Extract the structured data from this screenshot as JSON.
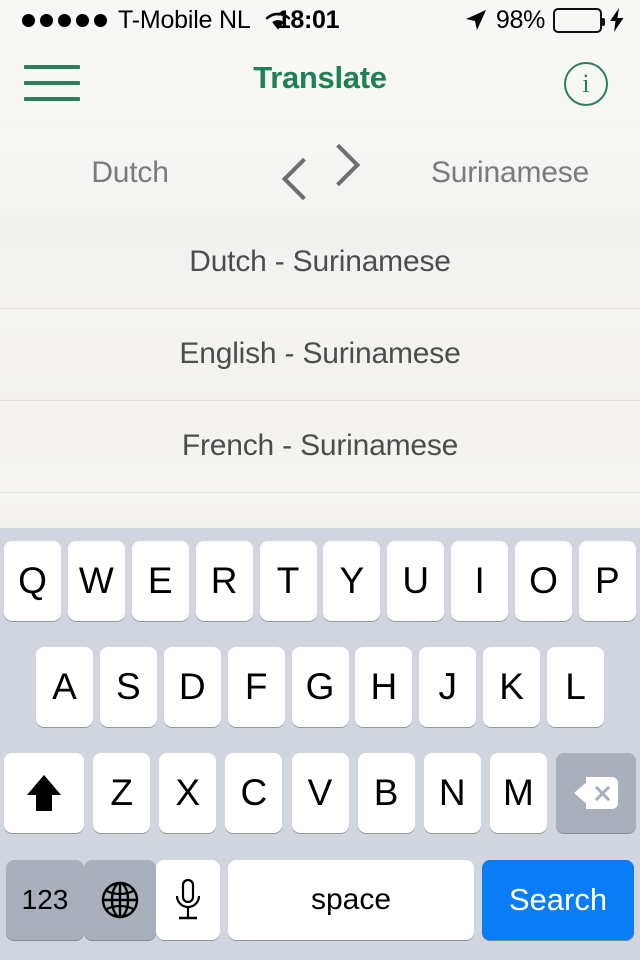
{
  "status_bar": {
    "signal_dots": 5,
    "carrier": "T-Mobile NL",
    "wifi_icon": "wifi-icon",
    "time": "18:01",
    "location_icon": "location-arrow-icon",
    "battery_percent": "98%",
    "battery_color": "#4cd964",
    "charging": true
  },
  "nav_bar": {
    "menu_icon": "hamburger-menu-icon",
    "title": "Translate",
    "info_label": "i",
    "accent_color": "#1f8055"
  },
  "language_picker": {
    "source_language": "Dutch",
    "target_language": "Surinamese",
    "swap_icon": "swap-chevrons-icon"
  },
  "suggestions": [
    {
      "label": "Dutch - Surinamese"
    },
    {
      "label": "English - Surinamese"
    },
    {
      "label": "French - Surinamese"
    }
  ],
  "keyboard": {
    "row1": [
      "Q",
      "W",
      "E",
      "R",
      "T",
      "Y",
      "U",
      "I",
      "O",
      "P"
    ],
    "row2": [
      "A",
      "S",
      "D",
      "F",
      "G",
      "H",
      "J",
      "K",
      "L"
    ],
    "row3": [
      "Z",
      "X",
      "C",
      "V",
      "B",
      "N",
      "M"
    ],
    "shift_icon": "shift-arrow-icon",
    "delete_icon": "backspace-delete-icon",
    "numbers_label": "123",
    "globe_icon": "globe-icon",
    "mic_icon": "microphone-icon",
    "space_label": "space",
    "return_label": "Search",
    "return_color": "#0a7cf5",
    "background_color": "#d1d5dd"
  }
}
